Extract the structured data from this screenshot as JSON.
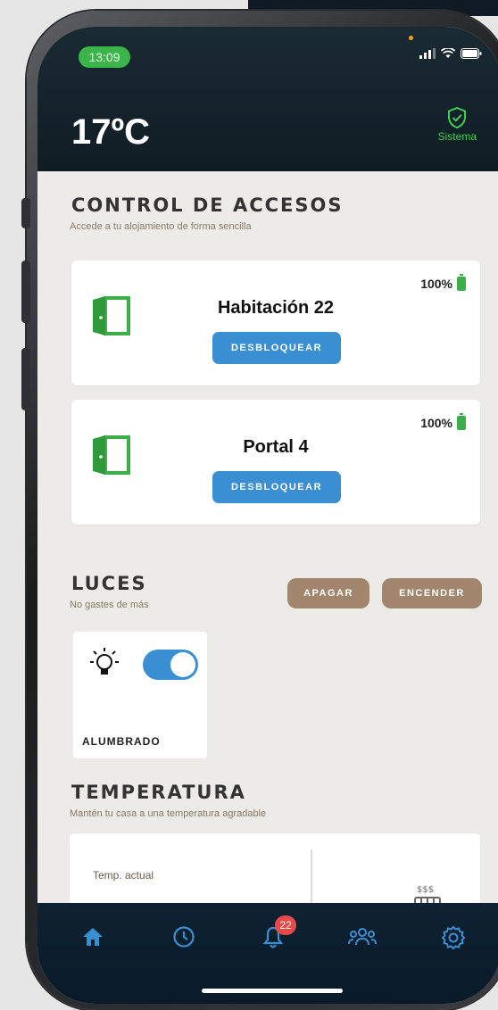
{
  "status_bar": {
    "time": "13:09"
  },
  "header": {
    "temperature": "17ºC",
    "system_label": "Sistema"
  },
  "access_control": {
    "title": "CONTROL DE ACCESOS",
    "subtitle": "Accede a tu alojamiento de forma sencilla",
    "doors": [
      {
        "name": "Habitación 22",
        "battery": "100%",
        "button": "DESBLOQUEAR"
      },
      {
        "name": "Portal 4",
        "battery": "100%",
        "button": "DESBLOQUEAR"
      }
    ]
  },
  "lights": {
    "title": "LUCES",
    "subtitle": "No gastes de más",
    "off_button": "APAGAR",
    "on_button": "ENCENDER",
    "items": [
      {
        "label": "ALUMBRADO",
        "on": true
      }
    ]
  },
  "temperature": {
    "title": "TEMPERATURA",
    "subtitle": "Mantén tu casa a una temperatura agradable",
    "current_label": "Temp. actual"
  },
  "tabbar": {
    "notification_count": "22"
  },
  "colors": {
    "accent_blue": "#3a8fd3",
    "brown_button": "#a1856c",
    "door_green": "#3cae4a",
    "system_green": "#3ccf52",
    "header_dark": "#0f1c24"
  }
}
